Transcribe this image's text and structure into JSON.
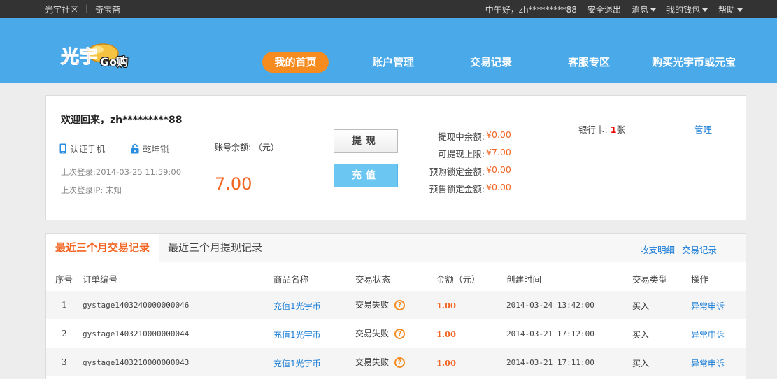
{
  "topbar": {
    "site_link": "光宇社区",
    "shop_link": "奇宝斋",
    "greeting": "中午好，zh*********88",
    "logout": "安全退出",
    "messages": "消息",
    "wallet": "我的钱包",
    "help": "帮助"
  },
  "header": {
    "logo_text": "光宇",
    "logo_go": "Go购",
    "nav": [
      {
        "label": "我的首页",
        "active": true
      },
      {
        "label": "账户管理",
        "active": false
      },
      {
        "label": "交易记录",
        "active": false
      },
      {
        "label": "客服专区",
        "active": false
      },
      {
        "label": "购买光宇币或元宝",
        "active": false
      }
    ]
  },
  "account": {
    "welcome": "欢迎回来，zh*********88",
    "verify_phone": "认证手机",
    "qiankun_lock": "乾坤锁",
    "last_login": "上次登录:2014-03-25 11:59:00",
    "last_login_ip": "上次登录IP: 未知",
    "balance_label": "账号余额: （元）",
    "balance_value": "7.00",
    "withdraw_button": "提现",
    "recharge_button": "充值",
    "amounts": [
      {
        "label": "提现中余额:",
        "value": "¥0.00"
      },
      {
        "label": "可提现上限:",
        "value": "¥7.00"
      },
      {
        "label": "预购锁定金额:",
        "value": "¥0.00"
      },
      {
        "label": "预售锁定金额:",
        "value": "¥0.00"
      }
    ],
    "bank_label": "银行卡:",
    "bank_count": "1",
    "bank_unit": "张",
    "bank_manage": "管理"
  },
  "records": {
    "tabs": [
      "最近三个月交易记录",
      "最近三个月提现记录"
    ],
    "links": [
      "收支明细",
      "交易记录"
    ],
    "columns": [
      "序号",
      "订单编号",
      "商品名称",
      "交易状态",
      "金额（元）",
      "创建时间",
      "交易类型",
      "操作"
    ],
    "rows": [
      {
        "no": "1",
        "order": "gystage1403240000000046",
        "product": "充值1光宇币",
        "status": "交易失败",
        "amount": "1.00",
        "created": "2014-03-24 13:42:00",
        "type": "买入",
        "action": "异常申诉"
      },
      {
        "no": "2",
        "order": "gystage1403210000000044",
        "product": "充值1光宇币",
        "status": "交易失败",
        "amount": "1.00",
        "created": "2014-03-21 17:12:00",
        "type": "买入",
        "action": "异常申诉"
      },
      {
        "no": "3",
        "order": "gystage1403210000000043",
        "product": "充值1光宇币",
        "status": "交易失败",
        "amount": "1.00",
        "created": "2014-03-21 17:11:00",
        "type": "买入",
        "action": "异常申诉"
      }
    ]
  },
  "colors": {
    "header_blue": "#4aa9e9",
    "accent_orange": "#f68c1f",
    "amount_orange": "#f26522",
    "link_blue": "#1c7ed6"
  }
}
